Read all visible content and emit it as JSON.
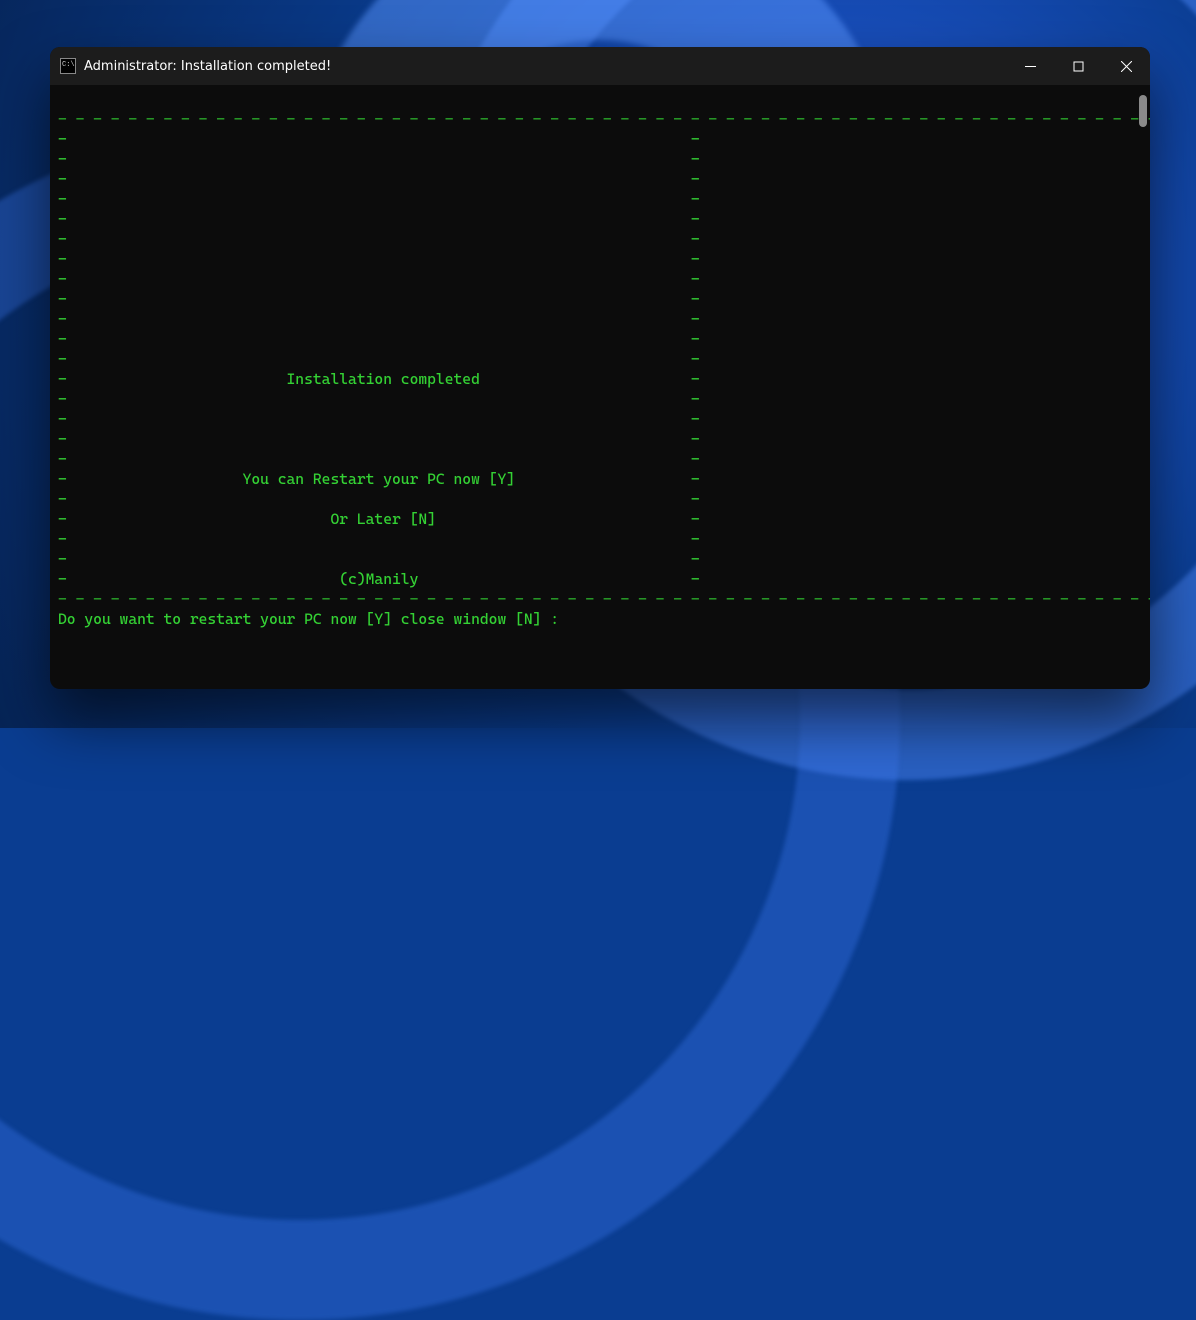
{
  "window": {
    "title": "Administrator:  Installation completed!"
  },
  "terminal": {
    "top_border_dashes": "- - - - - - - - - - - - - - - - - - - - - - - - - - - - - - - - - - - - - - - - - - - - - - - - - - - - - - - - - - - - - - - - - - - - - -",
    "bottom_border_dashes": "- - - - - - - - - - - - - - - - - - - - - - - - - - - - - - - - - - - - - - - - - - - - - - - - - - - - - - - - - - - - - - - - - - - - - -",
    "side_left": "-",
    "side_right": "-",
    "line_installation": "Installation completed",
    "line_restart": "You can Restart your PC now [Y]",
    "line_later": "Or Later [N]",
    "line_credit": "(c)Manily",
    "prompt": "Do you want to restart your PC now [Y] close window [N] :"
  }
}
